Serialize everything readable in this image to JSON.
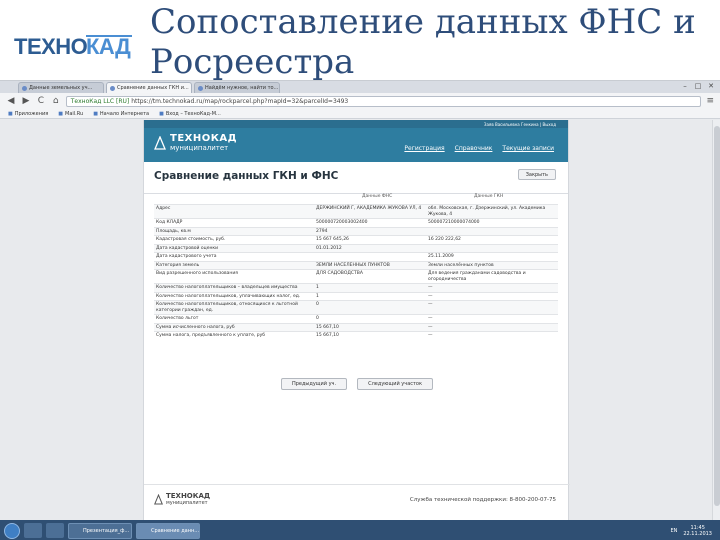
{
  "slide": {
    "title": "Сопоставление данных ФНС и Росреестра",
    "logo_text": "ТехноКад"
  },
  "browser": {
    "tabs": [
      {
        "label": "Данные земельных уч..."
      },
      {
        "label": "Сравнение данных ГКН и..."
      },
      {
        "label": "Найдём нужное, найти то..."
      }
    ],
    "nav": {
      "back": "◀",
      "forward": "▶",
      "reload": "C",
      "home": "⌂"
    },
    "address": {
      "secure_label": "ТехноКад LLC [RU]",
      "url": "https://tm.technokad.ru/map/rockparcel.php?mapId=32&parcelId=3493"
    },
    "bookmarks": [
      "Приложения",
      "Mail.Ru",
      "Начало Интернета",
      "Вход – ТехноКад-М..."
    ],
    "window_controls": [
      "–",
      "□",
      "✕"
    ],
    "menu_icon": "≡"
  },
  "site": {
    "top_links": "Заяв Васильевна Генкина   |  Выход",
    "brand": "ТЕХНОКАД",
    "brand_sub": "муниципалитет",
    "nav": [
      "Регистрация",
      "Справочник",
      "Текущие записи"
    ],
    "page_title": "Сравнение данных ГКН и ФНС",
    "close_label": "Закрыть",
    "col_fns": "Данные ФНС",
    "col_gkn": "Данные ГКН",
    "rows": [
      {
        "label": "Адрес",
        "fns": "ДЕРЖИНСКИЙ Г, АКАДЕМИКА ЖУКОВА УЛ, 4",
        "gkn": "обл. Московская, г. Дзержинский, ул. Академика Жукова, 4"
      },
      {
        "label": "Код КЛАДР",
        "fns": "500000720003002400",
        "gkn": "500007210000074000"
      },
      {
        "label": "Площадь, кв.м",
        "fns": "2794",
        "gkn": ""
      },
      {
        "label": "Кадастровая стоимость, руб.",
        "fns": "15 667 645,26",
        "gkn": "16 220 222,62"
      },
      {
        "label": "Дата кадастровой оценки",
        "fns": "01.01.2012",
        "gkn": ""
      },
      {
        "label": "Дата кадастрового учета",
        "fns": "",
        "gkn": "25.11.2009"
      },
      {
        "label": "Категория земель",
        "fns": "ЗЕМЛИ НАСЕЛЕННЫХ ПУНКТОВ",
        "gkn": "Земли населённых пунктов"
      },
      {
        "label": "Вид разрешенного использования",
        "fns": "ДЛЯ САДОВОДСТВА",
        "gkn": "Для ведения гражданами садоводства и огородничества"
      },
      {
        "label": "Количество налогоплательщиков – владельцев имущества",
        "fns": "1",
        "gkn": "—"
      },
      {
        "label": "Количество налогоплательщиков, уплачивающих налог, ед.",
        "fns": "1",
        "gkn": "—"
      },
      {
        "label": "Количество налогоплательщиков, относящихся к льготной категории граждан, ед.",
        "fns": "0",
        "gkn": "—"
      },
      {
        "label": "Количество льгот",
        "fns": "0",
        "gkn": "—"
      },
      {
        "label": "Сумма исчисленного налога, руб",
        "fns": "15 667,10",
        "gkn": "—"
      },
      {
        "label": "Сумма налога, предъявленного к уплате, руб",
        "fns": "15 667,10",
        "gkn": "—"
      }
    ],
    "btn_prev": "Предыдущий уч.",
    "btn_next": "Следующий участок",
    "footer_brand": "ТЕХНОКАД",
    "footer_sub": "муниципалитет",
    "support": "Служба технической поддержки: 8-800-200-07-75"
  },
  "taskbar": {
    "tasks": [
      {
        "label": "Презентация_ф..."
      },
      {
        "label": "Сравнение данн..."
      }
    ],
    "lang": "EN",
    "time": "11:45",
    "date": "22.11.2013"
  }
}
